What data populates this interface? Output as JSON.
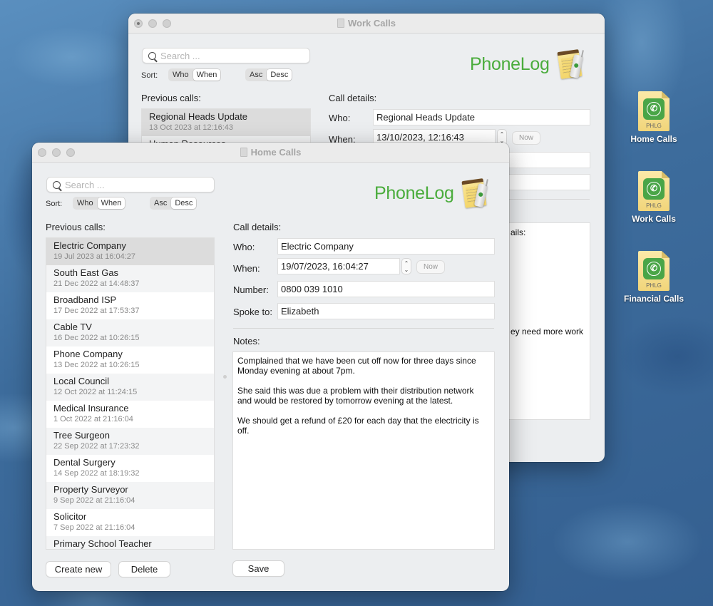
{
  "desktop": {
    "icons": [
      {
        "label": "Home Calls",
        "type": "PHLG"
      },
      {
        "label": "Work Calls",
        "type": "PHLG"
      },
      {
        "label": "Financial Calls",
        "type": "PHLG"
      }
    ]
  },
  "work_window": {
    "title": "Work Calls",
    "search_placeholder": "Search ...",
    "sort_label": "Sort:",
    "sort_by": [
      "Who",
      "When"
    ],
    "sort_order": [
      "Asc",
      "Desc"
    ],
    "logo": "PhoneLog",
    "previous_calls_label": "Previous calls:",
    "calls": [
      {
        "name": "Regional Heads Update",
        "date": "13 Oct 2023 at 12:16:43"
      },
      {
        "name": "Human Resources",
        "date": ""
      }
    ],
    "details_label": "Call details:",
    "who_label": "Who:",
    "who": "Regional Heads Update",
    "when_label": "When:",
    "when": "13/10/2023, 12:16:43",
    "now_label": "Now",
    "notes_fragment_1": "ails:",
    "notes_fragment_2": "ey need more work"
  },
  "home_window": {
    "title": "Home Calls",
    "search_placeholder": "Search ...",
    "sort_label": "Sort:",
    "sort_by": [
      "Who",
      "When"
    ],
    "sort_by_selected": "When",
    "sort_order": [
      "Asc",
      "Desc"
    ],
    "sort_order_selected": "Desc",
    "logo": "PhoneLog",
    "previous_calls_label": "Previous calls:",
    "calls": [
      {
        "name": "Electric Company",
        "date": "19 Jul 2023 at 16:04:27"
      },
      {
        "name": "South East Gas",
        "date": "21 Dec 2022 at 14:48:37"
      },
      {
        "name": "Broadband ISP",
        "date": "17 Dec 2022 at 17:53:37"
      },
      {
        "name": "Cable TV",
        "date": "16 Dec 2022 at 10:26:15"
      },
      {
        "name": "Phone Company",
        "date": "13 Dec 2022 at 10:26:15"
      },
      {
        "name": "Local Council",
        "date": "12 Oct 2022 at 11:24:15"
      },
      {
        "name": "Medical Insurance",
        "date": "1 Oct 2022 at 21:16:04"
      },
      {
        "name": "Tree Surgeon",
        "date": "22 Sep 2022 at 17:23:32"
      },
      {
        "name": "Dental Surgery",
        "date": "14 Sep 2022 at 18:19:32"
      },
      {
        "name": "Property Surveyor",
        "date": "9 Sep 2022 at 21:16:04"
      },
      {
        "name": "Solicitor",
        "date": "7 Sep 2022 at 21:16:04"
      },
      {
        "name": "Primary School Teacher",
        "date": ""
      }
    ],
    "details_label": "Call details:",
    "who_label": "Who:",
    "who": "Electric Company",
    "when_label": "When:",
    "when": "19/07/2023, 16:04:27",
    "now_label": "Now",
    "number_label": "Number:",
    "number": "0800 039 1010",
    "spoke_to_label": "Spoke to:",
    "spoke_to": "Elizabeth",
    "notes_label": "Notes:",
    "notes": "Complained that we have been cut off now for three days since Monday evening at about 7pm.\n\nShe said this was due a problem with their distribution network and would be restored by tomorrow evening at the latest.\n\nWe should get a refund of £20 for each day that the electricity is off.",
    "create_new_label": "Create new",
    "delete_label": "Delete",
    "save_label": "Save"
  }
}
